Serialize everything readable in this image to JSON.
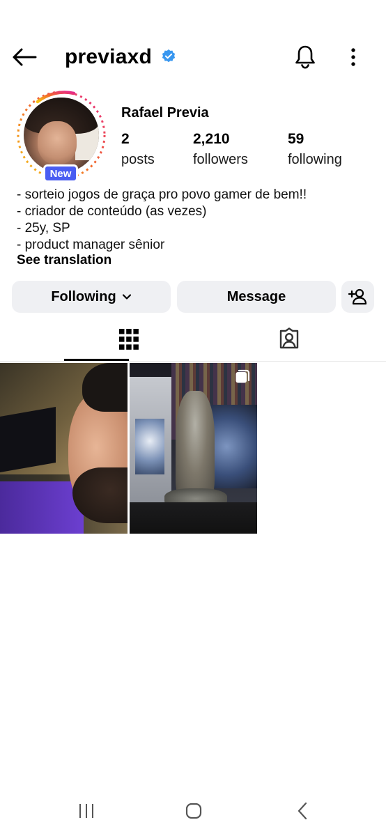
{
  "header": {
    "username": "previaxd",
    "verified": true,
    "icons": [
      "back-arrow-icon",
      "verified-badge-icon",
      "bell-icon",
      "more-vertical-icon"
    ]
  },
  "profile": {
    "full_name": "Rafael Previa",
    "new_badge": "New",
    "stats": {
      "posts_count": "2",
      "posts_label": "posts",
      "followers_count": "2,210",
      "followers_label": "followers",
      "following_count": "59",
      "following_label": "following"
    },
    "bio": [
      "- sorteio jogos de graça pro povo gamer de bem!!",
      "- criador de conteúdo (as vezes)",
      "- 25y, SP",
      "- product manager sênior"
    ],
    "see_translation": "See translation"
  },
  "actions": {
    "following_label": "Following",
    "message_label": "Message",
    "add_person_icon": "add-person-icon"
  },
  "tabs": [
    {
      "name": "grid",
      "icon": "grid-icon",
      "selected": true
    },
    {
      "name": "tagged",
      "icon": "tagged-person-icon",
      "selected": false
    }
  ],
  "posts": [
    {
      "kind": "photo",
      "description_icon": "selfie"
    },
    {
      "kind": "carousel",
      "description_icon": "figure"
    }
  ],
  "system_nav": [
    "recents-icon",
    "home-icon",
    "back-icon"
  ],
  "colors": {
    "accent_blue": "#4a5df2",
    "verified_blue": "#3897f0",
    "button_bg": "#eff0f3",
    "story_ring_start": "#e6288a",
    "story_ring_end": "#f5c518"
  }
}
